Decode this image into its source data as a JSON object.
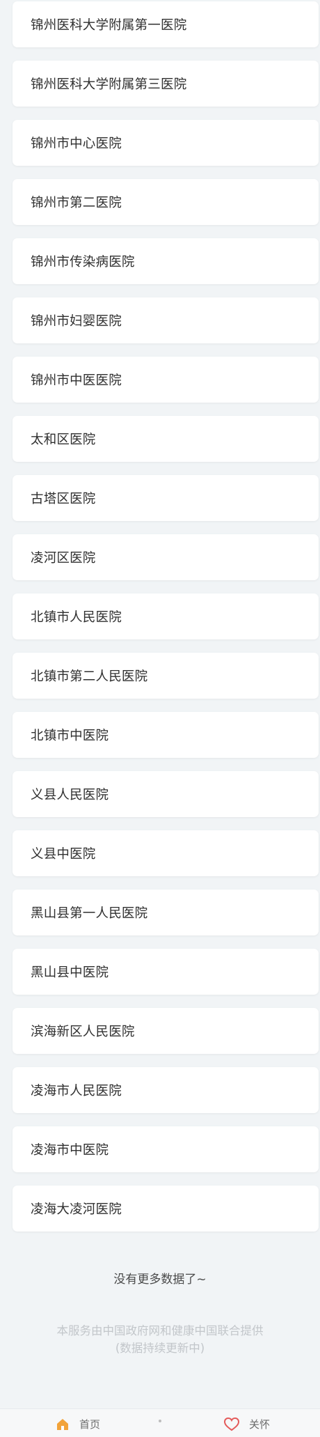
{
  "hospitals": [
    "锦州医科大学附属第一医院",
    "锦州医科大学附属第三医院",
    "锦州市中心医院",
    "锦州市第二医院",
    "锦州市传染病医院",
    "锦州市妇婴医院",
    "锦州市中医医院",
    "太和区医院",
    "古塔区医院",
    "凌河区医院",
    "北镇市人民医院",
    "北镇市第二人民医院",
    "北镇市中医院",
    "义县人民医院",
    "义县中医院",
    "黑山县第一人民医院",
    "黑山县中医院",
    "滨海新区人民医院",
    "凌海市人民医院",
    "凌海市中医院",
    "凌海大凌河医院"
  ],
  "end_text": "没有更多数据了~",
  "footer": {
    "line1": "本服务由中国政府网和健康中国联合提供",
    "line2": "(数据持续更新中)"
  },
  "tabbar": {
    "home_label": "首页",
    "care_label": "关怀",
    "icons": {
      "home": "home-icon",
      "middle": "dot-icon",
      "care": "heart-icon"
    },
    "colors": {
      "home_icon": "#f2a33a",
      "care_icon": "#e45a5a"
    }
  }
}
